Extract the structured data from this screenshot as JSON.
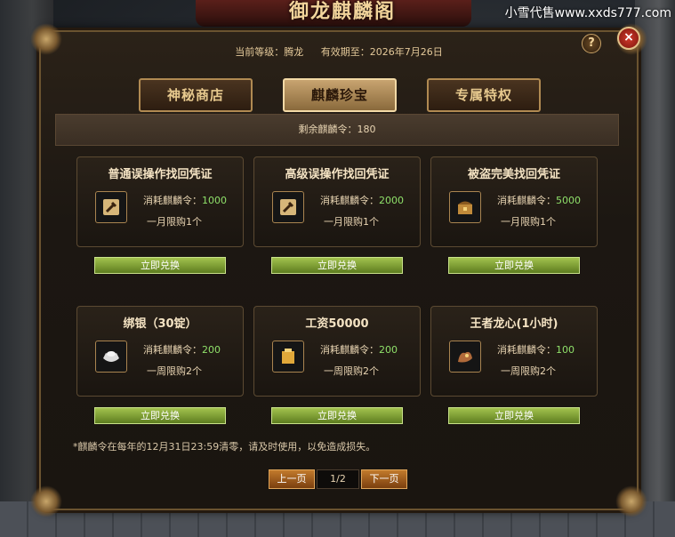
{
  "window": {
    "title": "御龙麒麟阁",
    "watermark": "小雪代售www.xxds777.com"
  },
  "info": {
    "level": "当前等级：腾龙",
    "expiry": "有效期至：2026年7月26日"
  },
  "tabs": [
    {
      "label": "神秘商店",
      "active": false
    },
    {
      "label": "麒麟珍宝",
      "active": true
    },
    {
      "label": "专属特权",
      "active": false
    }
  ],
  "remaining": "剩余麒麟令：180",
  "items": [
    {
      "title": "普通误操作找回凭证",
      "icon": "wrench-scroll-icon",
      "cost_label": "消耗麒麟令：",
      "cost": "1000",
      "limit": "一月限购1个",
      "button": "立即兑换"
    },
    {
      "title": "高级误操作找回凭证",
      "icon": "wrench-scroll-icon",
      "cost_label": "消耗麒麟令：",
      "cost": "2000",
      "limit": "一月限购1个",
      "button": "立即兑换"
    },
    {
      "title": "被盗完美找回凭证",
      "icon": "chest-icon",
      "cost_label": "消耗麒麟令：",
      "cost": "5000",
      "limit": "一月限购1个",
      "button": "立即兑换"
    },
    {
      "title": "绑银（30锭）",
      "icon": "silver-ingot-icon",
      "cost_label": "消耗麒麟令：",
      "cost": "200",
      "limit": "一周限购2个",
      "button": "立即兑换"
    },
    {
      "title": "工资50000",
      "icon": "gold-ingot-icon",
      "cost_label": "消耗麒麟令：",
      "cost": "200",
      "limit": "一周限购2个",
      "button": "立即兑换"
    },
    {
      "title": "王者龙心(1小时)",
      "icon": "dragon-heart-icon",
      "cost_label": "消耗麒麟令：",
      "cost": "100",
      "limit": "一周限购2个",
      "button": "立即兑换"
    }
  ],
  "note": "*麒麟令在每年的12月31日23:59清零，请及时使用，以免造成损失。",
  "pager": {
    "prev": "上一页",
    "page": "1/2",
    "next": "下一页"
  },
  "buttons": {
    "help": "?",
    "close": "×"
  }
}
